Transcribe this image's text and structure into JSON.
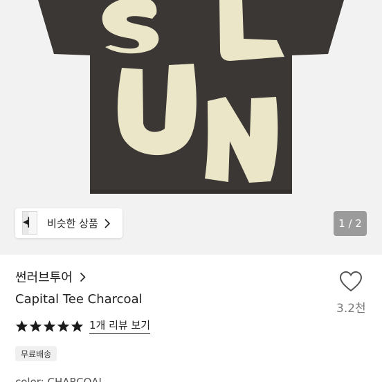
{
  "product_image": {
    "letters": [
      "S",
      "L",
      "U",
      "N"
    ],
    "shirt_color": "#3b3734",
    "patch_color": "#ece6c8",
    "background": "#f2f2f2"
  },
  "similar_button": {
    "label": "비슷한 상품"
  },
  "pager": {
    "text": "1 / 2"
  },
  "store": {
    "name": "썬러브투어"
  },
  "product": {
    "title": "Capital Tee Charcoal"
  },
  "likes": {
    "count": "3.2천"
  },
  "rating": {
    "stars": 5,
    "review_link": "1개 리뷰 보기"
  },
  "badges": {
    "shipping": "무료배송"
  },
  "option": {
    "text": "color: CHARCOAL"
  },
  "colors": {
    "star": "#1a1a1a",
    "text": "#222222",
    "muted": "#7a7a7a"
  }
}
